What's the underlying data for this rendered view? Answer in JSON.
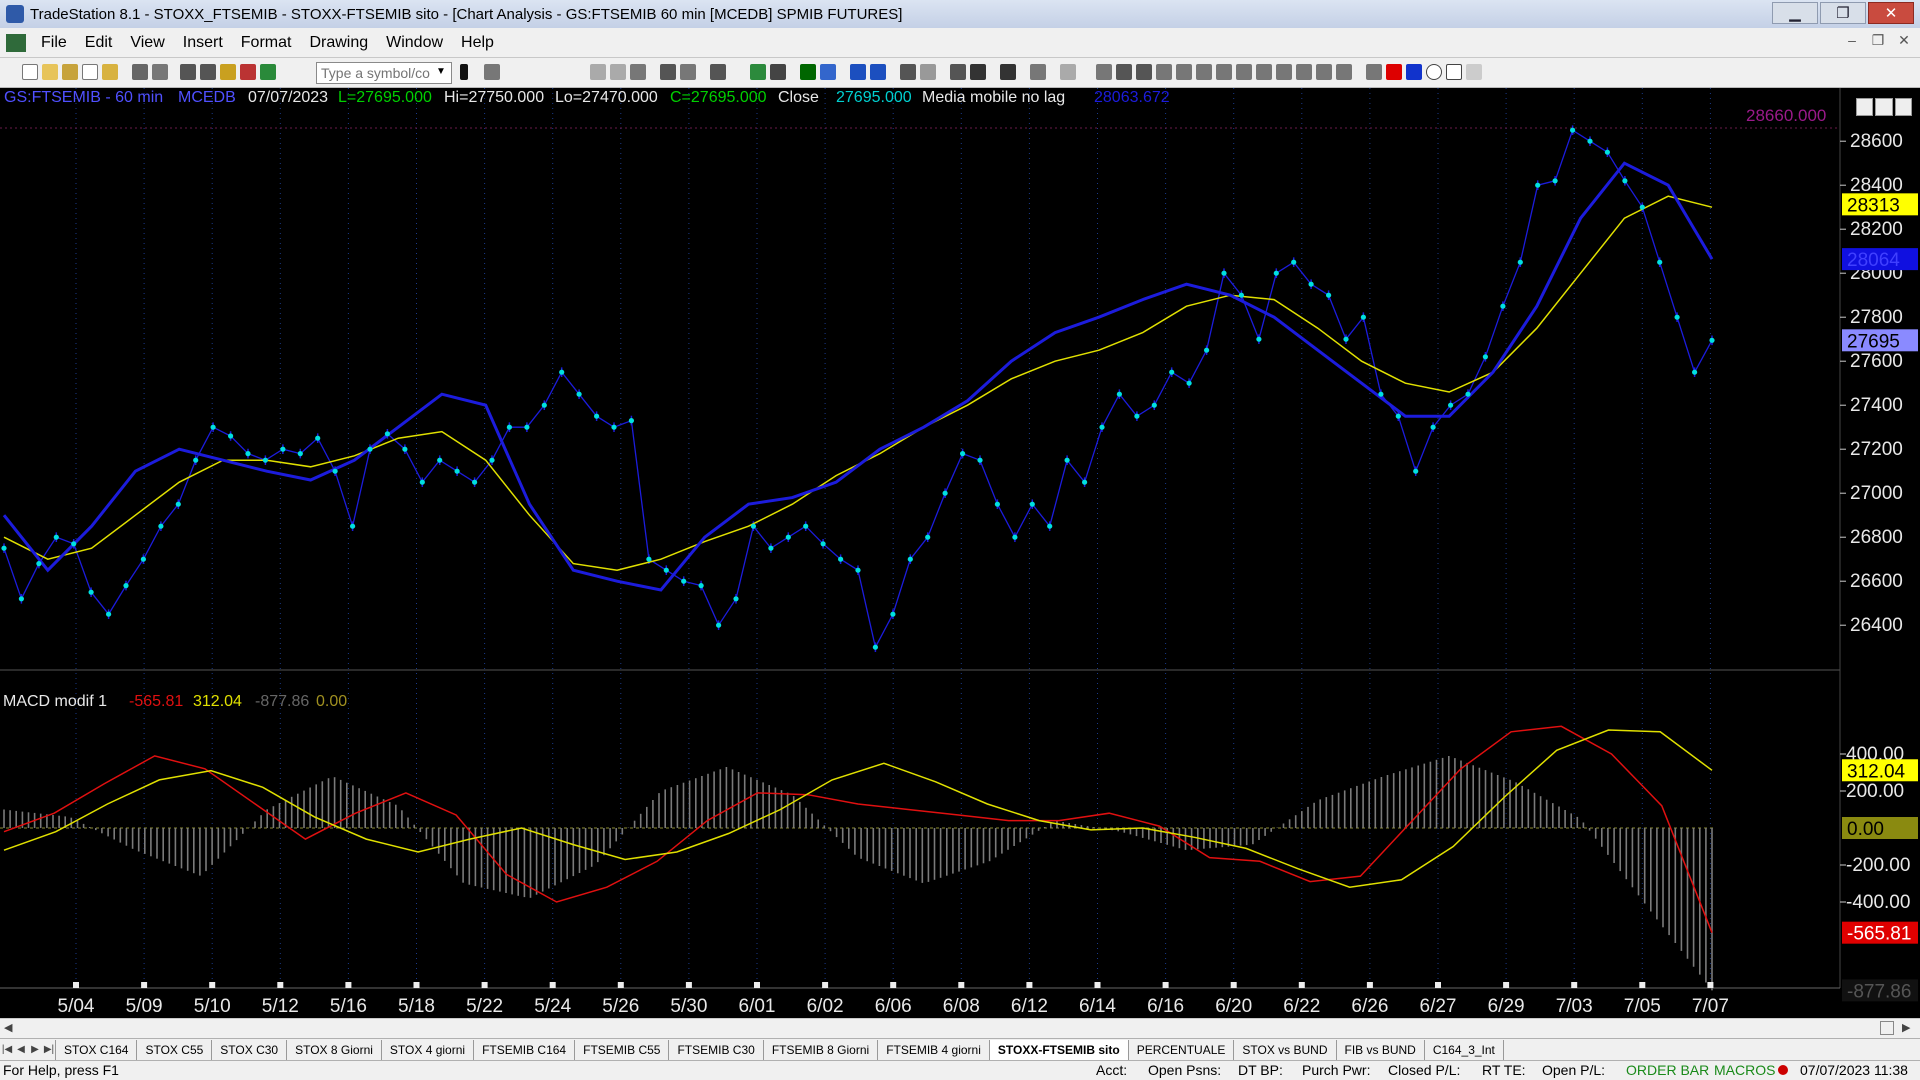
{
  "window": {
    "title": "TradeStation 8.1 - STOXX_FTSEMIB - STOXX-FTSEMIB sito - [Chart Analysis - GS:FTSEMIB  60 min  [MCEDB] SPMIB FUTURES]",
    "minimize": "▁",
    "restore": "❐",
    "close": "✕"
  },
  "menu": [
    "File",
    "Edit",
    "View",
    "Insert",
    "Format",
    "Drawing",
    "Window",
    "Help"
  ],
  "mdi_controls": [
    "–",
    "❐",
    "✕"
  ],
  "toolbar": {
    "symbol_placeholder": "Type a symbol/co"
  },
  "header": {
    "symbol": "GS:FTSEMIB - 60 min",
    "data_source": "MCEDB",
    "date": "07/07/2023",
    "last": "L=27695.000",
    "high": "Hi=27750.000",
    "low": "Lo=27470.000",
    "close_eq": "C=27695.000",
    "close_label": "Close",
    "close_value": "27695.000",
    "indicator_name": "Media mobile no lag",
    "indicator_value": "28063.672",
    "top_line_value": "28660.000"
  },
  "price_axis": {
    "ticks": [
      "28600",
      "28400",
      "28200",
      "28000",
      "27800",
      "27600",
      "27400",
      "27200",
      "27000",
      "26800",
      "26600",
      "26400"
    ],
    "marker_close": "27695",
    "marker_yellow": "28313",
    "marker_blue": "28064"
  },
  "macd": {
    "title": "MACD modif 1",
    "v1": "-565.81",
    "v2": "312.04",
    "v3": "-877.86",
    "v4": "0.00",
    "ticks": [
      "400.00",
      "200.00",
      "-200.00",
      "-400.00"
    ],
    "marker_yellow": "312.04",
    "marker_zero": "0.00",
    "marker_red": "-565.81",
    "marker_bottom": "-877.86"
  },
  "dates": [
    "5/04",
    "5/09",
    "5/10",
    "5/12",
    "5/16",
    "5/18",
    "5/22",
    "5/24",
    "5/26",
    "5/30",
    "6/01",
    "6/02",
    "6/06",
    "6/08",
    "6/12",
    "6/14",
    "6/16",
    "6/20",
    "6/22",
    "6/26",
    "6/27",
    "6/29",
    "7/03",
    "7/05",
    "7/07"
  ],
  "tabs": [
    "STOX C164",
    "STOX C55",
    "STOX  C30",
    "STOX  8 Giorni",
    "STOX 4 giorni",
    "FTSEMIB C164",
    "FTSEMIB C55",
    "FTSEMIB C30",
    "FTSEMIB  8 Giorni",
    "FTSEMIB  4 giorni",
    "STOXX-FTSEMIB sito",
    "PERCENTUALE",
    "STOX vs BUND",
    "FIB vs BUND",
    "C164_3_Int"
  ],
  "status": {
    "help": "For Help, press F1",
    "acct": "Acct:",
    "open_psns": "Open Psns:",
    "dt_bp": "DT BP:",
    "purch_pwr": "Purch Pwr:",
    "closed_pl": "Closed P/L:",
    "rt_te": "RT TE:",
    "open_pl": "Open P/L:",
    "order_bar": "ORDER BAR",
    "macros": "MACROS",
    "clock": "07/07/2023 11:38"
  },
  "colors": {
    "price": "#00e0e0",
    "fast_ma": "#e0e000",
    "slow_ma": "#1c1cdc",
    "macd_red": "#e01010",
    "macd_yellow": "#e0e000",
    "hist": "#7a7a7a",
    "grid": "#1a3a8a",
    "header_blue": "#5050ff",
    "header_green": "#00d000"
  },
  "chart_data": [
    {
      "type": "line",
      "title": "GS:FTSEMIB - 60 min",
      "ylim": [
        26200,
        28760
      ],
      "series": [
        {
          "name": "Close",
          "values": [
            26750,
            26520,
            26680,
            26800,
            26770,
            26550,
            26450,
            26580,
            26700,
            26850,
            26950,
            27150,
            27300,
            27260,
            27180,
            27150,
            27200,
            27180,
            27250,
            27100,
            26850,
            27200,
            27270,
            27200,
            27050,
            27150,
            27100,
            27050,
            27150,
            27300,
            27300,
            27400,
            27550,
            27450,
            27350,
            27300,
            27330,
            26700,
            26650,
            26600,
            26580,
            26400,
            26520,
            26850,
            26750,
            26800,
            26850,
            26770,
            26700,
            26650,
            26300,
            26450,
            26700,
            26800,
            27000,
            27180,
            27150,
            26950,
            26800,
            26950,
            26850,
            27150,
            27050,
            27300,
            27450,
            27350,
            27400,
            27550,
            27500,
            27650,
            28000,
            27900,
            27700,
            28000,
            28050,
            27950,
            27900,
            27700,
            27800,
            27450,
            27350,
            27100,
            27300,
            27400,
            27450,
            27620,
            27850,
            28050,
            28400,
            28420,
            28650,
            28600,
            28550,
            28420,
            28300,
            28050,
            27800,
            27550,
            27695
          ]
        },
        {
          "name": "Media mobile no lag",
          "values": [
            26800,
            26700,
            26750,
            26900,
            27050,
            27150,
            27150,
            27120,
            27170,
            27250,
            27280,
            27150,
            26900,
            26680,
            26650,
            26700,
            26780,
            26850,
            26950,
            27080,
            27180,
            27300,
            27400,
            27520,
            27600,
            27650,
            27730,
            27850,
            27900,
            27880,
            27750,
            27600,
            27500,
            27460,
            27550,
            27750,
            28000,
            28250,
            28350,
            28300
          ]
        },
        {
          "name": "Slow average",
          "values": [
            26900,
            26650,
            26850,
            27100,
            27200,
            27150,
            27100,
            27060,
            27150,
            27300,
            27450,
            27400,
            26950,
            26650,
            26600,
            26560,
            26800,
            26950,
            26980,
            27050,
            27200,
            27300,
            27420,
            27600,
            27730,
            27800,
            27880,
            27950,
            27900,
            27800,
            27650,
            27500,
            27350,
            27350,
            27550,
            27850,
            28250,
            28500,
            28400,
            28064
          ]
        }
      ]
    },
    {
      "type": "line",
      "title": "MACD modif 1",
      "ylim": [
        -900,
        500
      ],
      "series": [
        {
          "name": "MACD",
          "values": [
            -20,
            80,
            240,
            390,
            320,
            130,
            -60,
            80,
            190,
            70,
            -250,
            -400,
            -320,
            -180,
            40,
            190,
            180,
            130,
            100,
            70,
            40,
            40,
            80,
            10,
            -160,
            -180,
            -290,
            -260,
            30,
            320,
            520,
            550,
            400,
            120,
            -565.81
          ]
        },
        {
          "name": "Signal",
          "values": [
            -120,
            -20,
            130,
            260,
            310,
            220,
            60,
            -60,
            -130,
            -60,
            0,
            -90,
            -170,
            -130,
            -30,
            100,
            260,
            350,
            250,
            130,
            40,
            -10,
            0,
            -50,
            -110,
            -220,
            -320,
            -280,
            -100,
            170,
            420,
            530,
            520,
            312.04
          ]
        },
        {
          "name": "Histogram",
          "values": [
            100,
            60,
            -120,
            -260,
            100,
            280,
            120,
            -300,
            -380,
            -200,
            200,
            330,
            180,
            -160,
            -300,
            -180,
            40,
            -20,
            -120,
            -90,
            150,
            280,
            390,
            250,
            50,
            -420,
            -877.86
          ]
        }
      ]
    }
  ]
}
